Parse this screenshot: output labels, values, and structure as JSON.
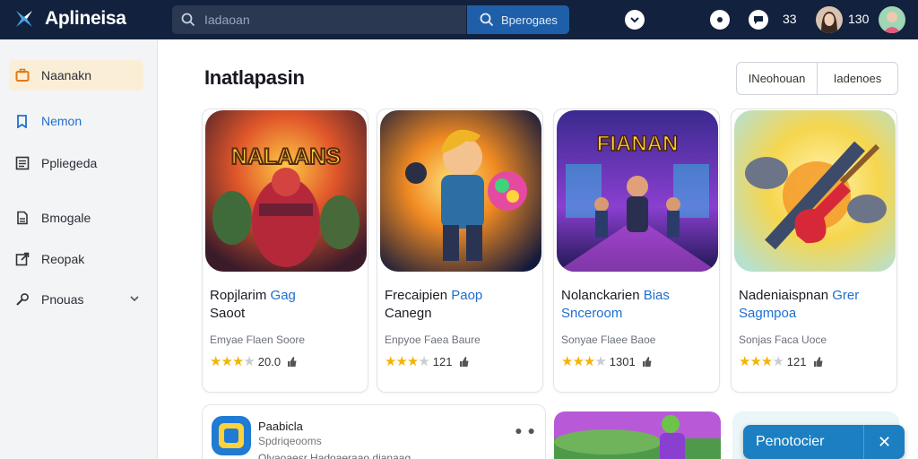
{
  "app": {
    "name": "Aplineisa",
    "brand_color": "#12213d",
    "accent_color": "#1e6fd0"
  },
  "search": {
    "placeholder": "Iadaoan",
    "button_label": "Bperogaes"
  },
  "header": {
    "count_a": "33",
    "count_b": "130"
  },
  "sidebar": {
    "items": [
      {
        "label": "Naanakn",
        "icon": "briefcase-icon"
      },
      {
        "label": "Nemon",
        "icon": "bookmark-icon"
      },
      {
        "label": "Ppliegeda",
        "icon": "list-icon"
      },
      {
        "label": "Bmogale",
        "icon": "document-icon"
      },
      {
        "label": "Reopak",
        "icon": "export-icon"
      },
      {
        "label": "Pnouas",
        "icon": "tools-icon"
      }
    ]
  },
  "main": {
    "title": "Inatlapasin",
    "filters": [
      "INeohouan",
      "Iadenoes"
    ]
  },
  "cards": [
    {
      "title": "Ropjlarim",
      "title_accent": "Gag",
      "title_line2": "Saoot",
      "developer": "Emyae Flaen Soore",
      "rating_text": "20.0",
      "stars": 3.5,
      "art_text": "NALAANS"
    },
    {
      "title": "Frecaipien",
      "title_accent": "Paop",
      "title_line2": "Canegn",
      "developer": "Enpyoe Faea Baure",
      "rating_text": "121",
      "stars": 3.5,
      "art_text": ""
    },
    {
      "title": "Nolanckarien",
      "title_accent": "Bias",
      "title_line2_accent": "Snceroom",
      "developer": "Sonyae Flaee Baoe",
      "rating_text": "1301",
      "stars": 3.5,
      "art_text": "FIANAN"
    },
    {
      "title": "Nadeniaispnan",
      "title_accent": "Grer",
      "title_line2_accent": "Sagmpoa",
      "developer": "Sonjas Faca Uoce",
      "rating_text": "121",
      "stars": 3.5,
      "art_text": ""
    }
  ],
  "bottom": {
    "featured_title": "Paabicla",
    "featured_sub": "Spdriqeooms",
    "featured_desc": "Olvaoaesr Hadoaeraao dianaag"
  },
  "toast": {
    "label": "Penotocier"
  }
}
